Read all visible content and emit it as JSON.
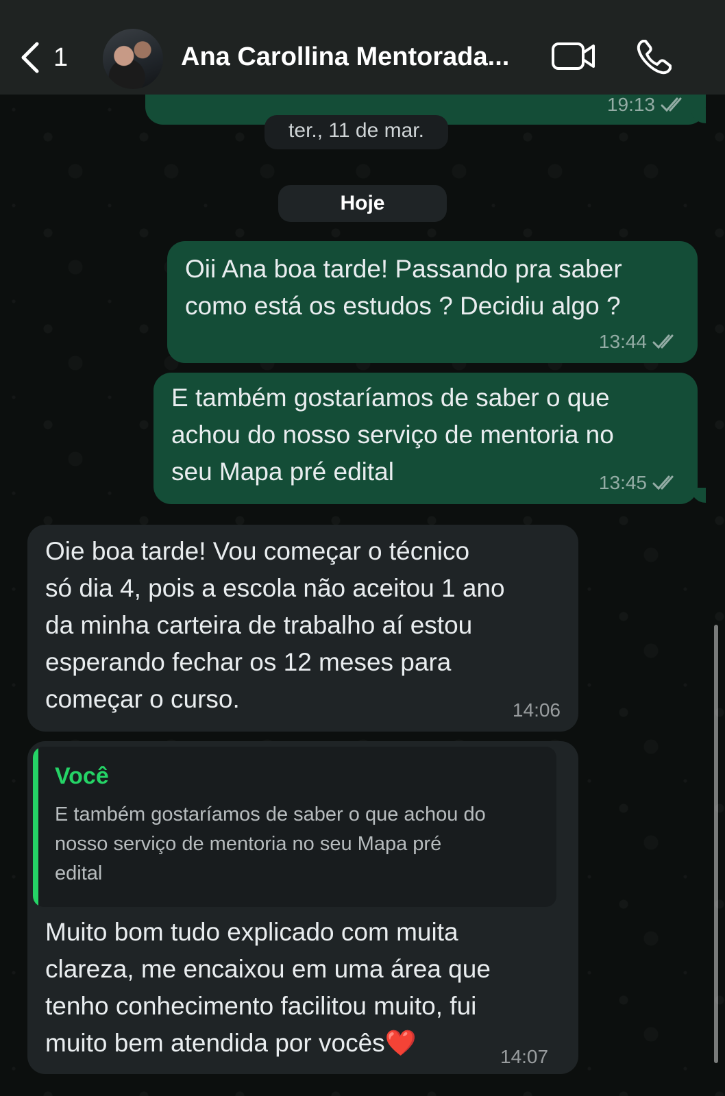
{
  "header": {
    "back_count": "1",
    "contact_name": "Ana Carollina Mentorada..."
  },
  "messages": [
    {
      "direction": "out",
      "text": "",
      "time": "19:13",
      "status": "read"
    },
    {
      "direction": "out",
      "text": "Oii Ana boa tarde! Passando pra saber\ncomo está os estudos ? Decidiu algo ?",
      "time": "13:44",
      "status": "read"
    },
    {
      "direction": "out",
      "text": "E também gostaríamos de saber o que\nachou do nosso serviço de mentoria no\nseu Mapa pré edital",
      "time": "13:45",
      "status": "read"
    },
    {
      "direction": "in",
      "text": "Oie boa tarde! Vou começar o técnico\nsó dia 4, pois a escola não aceitou 1 ano\nda minha carteira de trabalho aí estou\nesperando fechar os 12 meses para\ncomeçar o curso.",
      "time": "14:06"
    },
    {
      "direction": "in",
      "reply_to": {
        "author": "Você",
        "text": "E também gostaríamos de saber o que achou do\nnosso serviço de mentoria no seu Mapa pré\nedital"
      },
      "text": "Muito bom tudo explicado com muita\nclareza,  me encaixou em uma área que\ntenho conhecimento facilitou muito, fui\nmuito bem atendida por vocês",
      "emoji": "❤️",
      "time": "14:07"
    }
  ],
  "date_separators": [
    "ter., 11 de mar.",
    "Hoje"
  ],
  "icons": [
    "back-chevron-icon",
    "video-call-icon",
    "phone-icon",
    "double-check-icon",
    "heart-emoji-icon"
  ],
  "colors": {
    "outgoing_bubble": "#144d37",
    "incoming_bubble": "#1f2426",
    "reply_accent": "#25d366",
    "header_bg": "#1f2322"
  }
}
